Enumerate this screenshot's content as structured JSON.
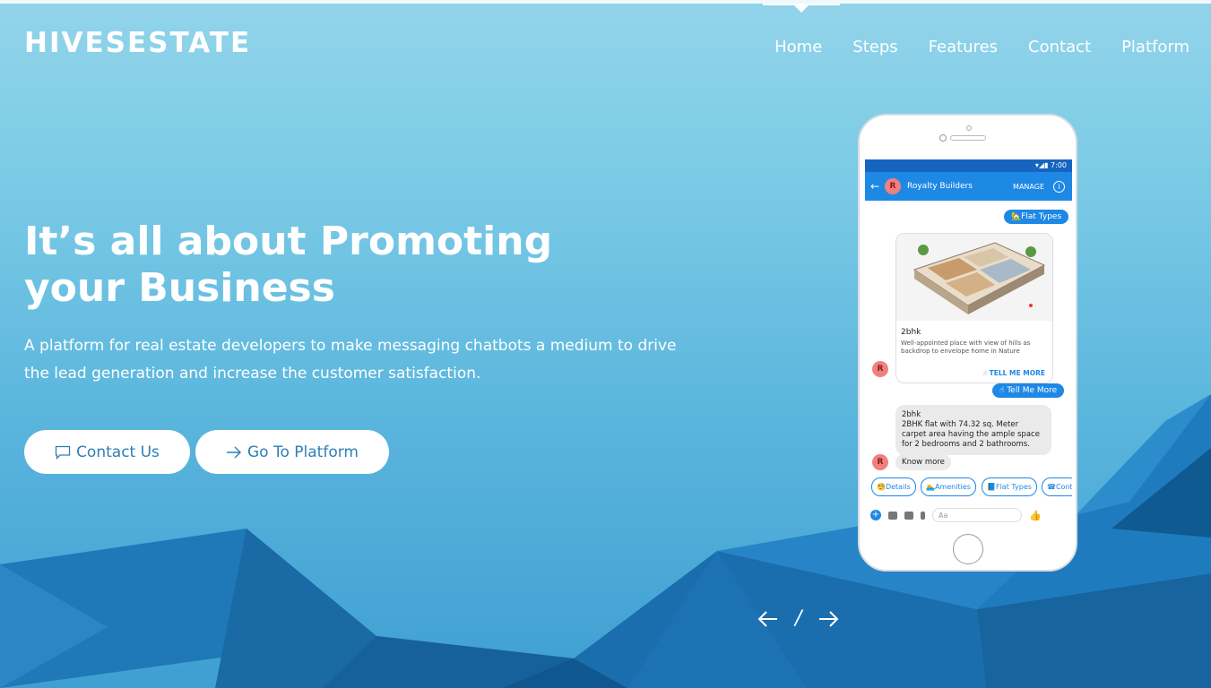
{
  "brand": {
    "logo": "HIVESESTATE"
  },
  "nav": {
    "items": [
      "Home",
      "Steps",
      "Features",
      "Contact",
      "Platform"
    ],
    "active": "Home"
  },
  "hero": {
    "title": "It’s all about Promoting your Business",
    "subtitle": "A platform for real estate developers to make messaging chatbots a medium to drive the lead generation and increase the customer satisfaction.",
    "buttons": {
      "contact": "Contact Us",
      "platform": "Go To Platform"
    }
  },
  "pager": {
    "separator": "/"
  },
  "phone": {
    "status_time": "7:00",
    "chat_name": "Royalty Builders",
    "avatar_letter": "R",
    "manage": "MANAGE",
    "chip_flat_types": "🏡Flat Types",
    "card": {
      "title": "2bhk",
      "desc": "Well-appointed place with view of hills as backdrop to envelope home in Nature",
      "more": "☝ TELL ME MORE"
    },
    "chip_tell_me_more": "☝ Tell Me More",
    "bubble": {
      "line1": "2bhk",
      "line2": "2BHK flat with 74.32 sq. Meter carpet area having the ample space for 2 bedrooms and 2 bathrooms."
    },
    "know_more": "Know more",
    "quick_replies": [
      "🧐Details",
      "🏊Amenities",
      "📘Flat Types",
      "☎Cont"
    ],
    "composer_placeholder": "Aa"
  },
  "colors": {
    "sky_top": "#92d4ea",
    "sky_bottom": "#3f9fd2",
    "button_text": "#2e7fb5",
    "messenger_blue": "#1e88e5"
  }
}
